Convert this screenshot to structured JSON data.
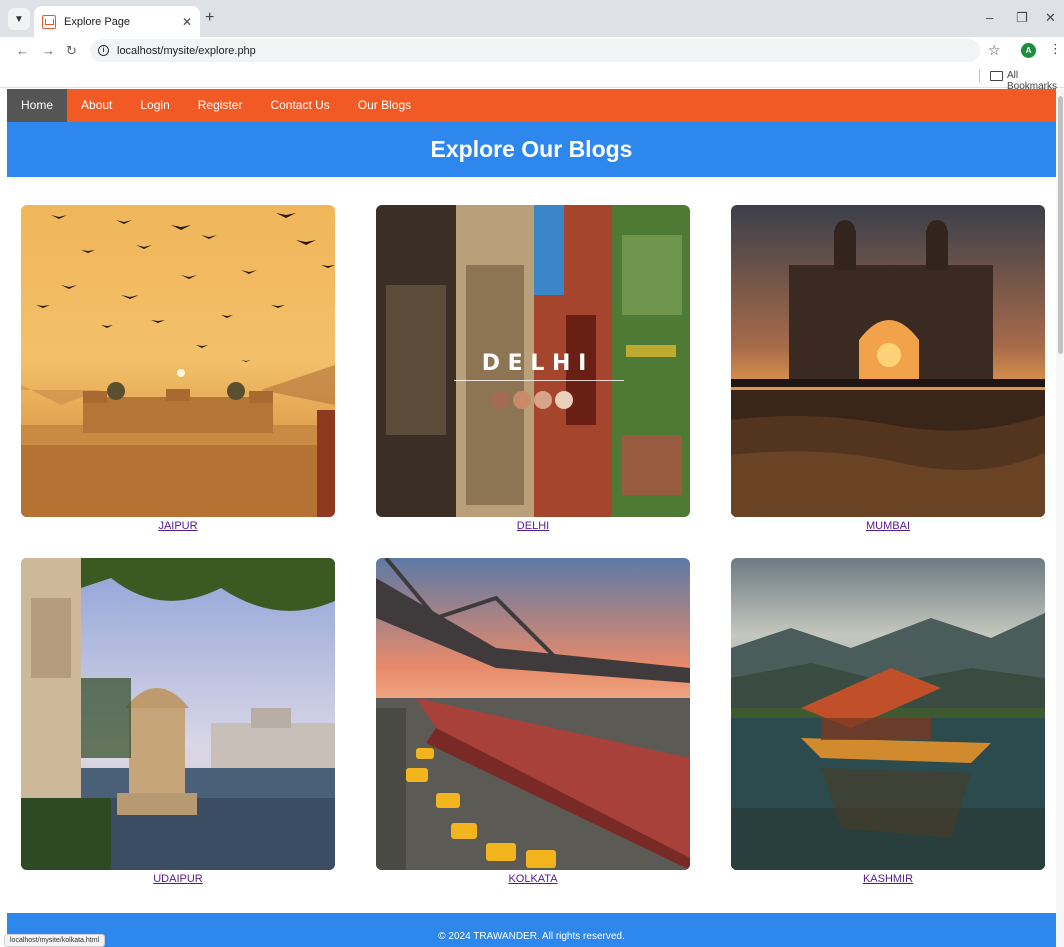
{
  "browser": {
    "tab_title": "Explore Page",
    "url": "localhost/mysite/explore.php",
    "bookmarks_label": "All Bookmarks",
    "profile_initial": "A",
    "status_url": "localhost/mysite/kolkata.html"
  },
  "nav": {
    "items": [
      "Home",
      "About",
      "Login",
      "Register",
      "Contact Us",
      "Our Blogs"
    ],
    "active_index": 0
  },
  "hero": {
    "title": "Explore Our Blogs"
  },
  "cards": [
    {
      "label": "JAIPUR"
    },
    {
      "label": "DELHI",
      "overlay_text": "D E L H I"
    },
    {
      "label": "MUMBAI"
    },
    {
      "label": "UDAIPUR"
    },
    {
      "label": "KOLKATA"
    },
    {
      "label": "KASHMIR"
    }
  ],
  "footer": {
    "text": "© 2024 TRAWANDER. All rights reserved."
  },
  "colors": {
    "nav_bg": "#f15a24",
    "hero_bg": "#2d87ec",
    "nav_active": "#555555"
  }
}
